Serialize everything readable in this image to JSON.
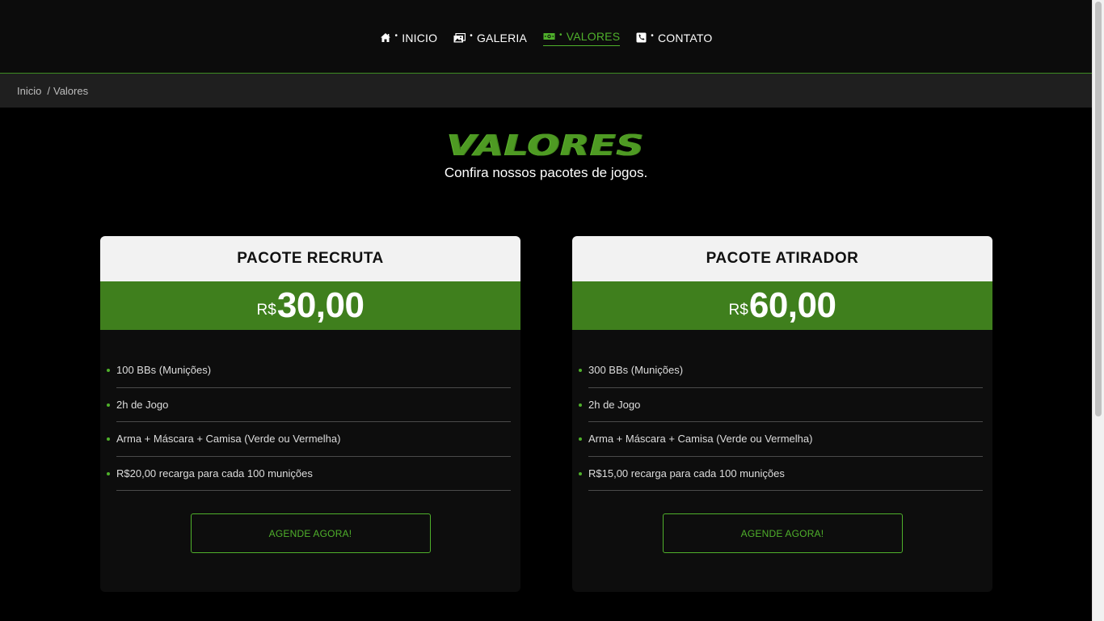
{
  "nav": {
    "items": [
      {
        "label": "INICIO",
        "icon": "home-icon",
        "active": false
      },
      {
        "label": "GALERIA",
        "icon": "gallery-icon",
        "active": false
      },
      {
        "label": "VALORES",
        "icon": "money-icon",
        "active": true
      },
      {
        "label": "CONTATO",
        "icon": "phone-icon",
        "active": false
      }
    ],
    "separator": "•"
  },
  "breadcrumb": {
    "home": "Inicio",
    "separator": "/",
    "current": "Valores"
  },
  "heading": {
    "title": "VALORES",
    "subtitle": "Confira nossos pacotes de jogos."
  },
  "packages": [
    {
      "name": "PACOTE RECRUTA",
      "currency": "R$",
      "price": "30,00",
      "features": [
        "100 BBs (Munições)",
        "2h de Jogo",
        "Arma + Máscara + Camisa (Verde ou Vermelha)",
        "R$20,00 recarga para cada 100 munições"
      ],
      "cta": "AGENDE AGORA!"
    },
    {
      "name": "PACOTE ATIRADOR",
      "currency": "R$",
      "price": "60,00",
      "features": [
        "300 BBs (Munições)",
        "2h de Jogo",
        "Arma + Máscara + Camisa (Verde ou Vermelha)",
        "R$15,00 recarga para cada 100 munições"
      ],
      "cta": "AGENDE AGORA!"
    }
  ],
  "colors": {
    "accent": "#4fb02b",
    "price_band": "#3f7f1d",
    "nav_bg": "#0c0c0c",
    "breadcrumb_bg": "#1f1f1f"
  }
}
